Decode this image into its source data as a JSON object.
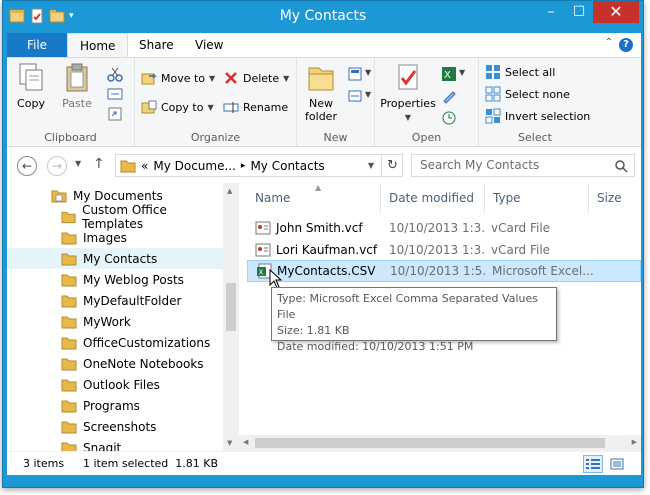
{
  "window": {
    "title": "My Contacts",
    "controls": {
      "minimize": "–",
      "maximize": "☐",
      "close": "✕"
    }
  },
  "ribbon_tabs": [
    {
      "label": "File"
    },
    {
      "label": "Home"
    },
    {
      "label": "Share"
    },
    {
      "label": "View"
    }
  ],
  "ribbon": {
    "clipboard": {
      "label": "Clipboard",
      "copy": "Copy",
      "paste": "Paste"
    },
    "organize": {
      "label": "Organize",
      "move_to": "Move to",
      "copy_to": "Copy to",
      "delete": "Delete",
      "rename": "Rename"
    },
    "new": {
      "label": "New",
      "new_folder_line1": "New",
      "new_folder_line2": "folder"
    },
    "open": {
      "label": "Open",
      "properties": "Properties"
    },
    "select": {
      "label": "Select",
      "select_all": "Select all",
      "select_none": "Select none",
      "invert_selection": "Invert selection"
    }
  },
  "address": {
    "breadcrumb_overflow": "«",
    "crumb1": "My Docume...",
    "crumb2": "My Contacts",
    "search_placeholder": "Search My Contacts"
  },
  "nav_tree": {
    "root": "My Documents",
    "items": [
      {
        "label": "Custom Office Templates"
      },
      {
        "label": "Images"
      },
      {
        "label": "My Contacts"
      },
      {
        "label": "My Weblog Posts"
      },
      {
        "label": "MyDefaultFolder"
      },
      {
        "label": "MyWork"
      },
      {
        "label": "OfficeCustomizations"
      },
      {
        "label": "OneNote Notebooks"
      },
      {
        "label": "Outlook Files"
      },
      {
        "label": "Programs"
      },
      {
        "label": "Screenshots"
      },
      {
        "label": "Snagit"
      }
    ]
  },
  "columns": {
    "name": "Name",
    "date": "Date modified",
    "type": "Type",
    "size": "Size"
  },
  "files": [
    {
      "name": "John Smith.vcf",
      "date": "10/10/2013 1:3...",
      "type": "vCard File"
    },
    {
      "name": "Lori Kaufman.vcf",
      "date": "10/10/2013 1:3...",
      "type": "vCard File"
    },
    {
      "name": "MyContacts.CSV",
      "date": "10/10/2013 1:5...",
      "type": "Microsoft Excel..."
    }
  ],
  "tooltip": {
    "type": "Type: Microsoft Excel Comma Separated Values File",
    "size": "Size: 1.81 KB",
    "date": "Date modified: 10/10/2013 1:51 PM"
  },
  "status": {
    "count": "3 items",
    "selection": "1 item selected  1.81 KB"
  },
  "colors": {
    "titlebar": "#1c98d6",
    "file_tab": "#1979c9",
    "selection": "#cce8ff",
    "folder": "#e8b84a"
  }
}
